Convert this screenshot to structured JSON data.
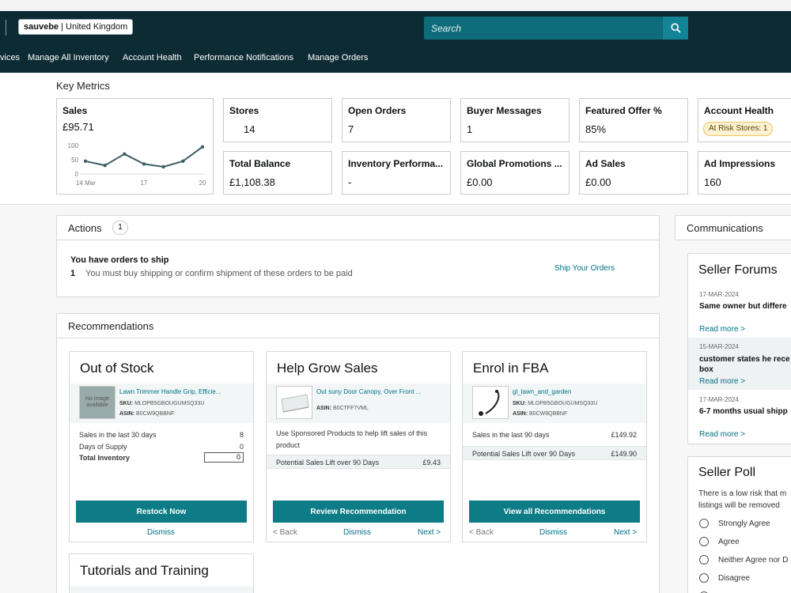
{
  "header": {
    "store_name": "sauvebe",
    "store_region": "United Kingdom",
    "search_placeholder": "Search"
  },
  "nav": {
    "items": [
      "vices",
      "Manage All Inventory",
      "Account Health",
      "Performance Notifications",
      "Manage Orders"
    ]
  },
  "key_metrics": {
    "title": "Key Metrics",
    "sales": {
      "label": "Sales",
      "value": "£95.71",
      "chart_data": {
        "type": "line",
        "x": [
          "14 Mar",
          "15 Mar",
          "16 Mar",
          "17 Mar",
          "18 Mar",
          "19 Mar",
          "20 Mar"
        ],
        "values": [
          45,
          30,
          70,
          35,
          25,
          45,
          95
        ],
        "yticks": [
          "100",
          "50",
          "0"
        ],
        "xticks": [
          "14 Mar",
          "17",
          "20"
        ],
        "ylim": [
          0,
          100
        ]
      }
    },
    "tiles": [
      {
        "label": "Stores",
        "value": "14"
      },
      {
        "label": "Open Orders",
        "value": "7"
      },
      {
        "label": "Buyer Messages",
        "value": "1"
      },
      {
        "label": "Featured Offer %",
        "value": "85%"
      },
      {
        "label": "Account Health",
        "badge": "At Risk Stores: 1"
      },
      {
        "label": "Total Balance",
        "value": "£1,108.38"
      },
      {
        "label": "Inventory Performa...",
        "value": "-"
      },
      {
        "label": "Global Promotions ...",
        "value": "£0.00"
      },
      {
        "label": "Ad Sales",
        "value": "£0.00"
      },
      {
        "label": "Ad Impressions",
        "value": "160"
      }
    ]
  },
  "actions": {
    "title": "Actions",
    "count": "1",
    "heading": "You have orders to ship",
    "item_count": "1",
    "item_text": "You must buy shipping or confirm shipment of these orders to be paid",
    "link": "Ship Your Orders"
  },
  "recommendations": {
    "title": "Recommendations",
    "cards": [
      {
        "title": "Out of Stock",
        "thumb_text": "No image available",
        "product": "Lawn Trimmer Handle Grip, Efficie...",
        "sku_label": "SKU:",
        "sku": "MLOPB5GBOUGUMSQ33U",
        "asin_label": "ASIN:",
        "asin": "B0CW9QBBNF",
        "rows": [
          {
            "label": "Sales in the last 30 days",
            "value": "8"
          },
          {
            "label": "Days of Supply",
            "value": "0"
          },
          {
            "label": "Total Inventory",
            "value": "0"
          }
        ],
        "button": "Restock Now",
        "dismiss": "Dismiss"
      },
      {
        "title": "Help Grow Sales",
        "product": "Out suny Door Canopy, Over Front ...",
        "asin_label": "ASIN:",
        "asin": "B0CTFF7VML",
        "text": "Use Sponsored Products to help lift sales of this product",
        "band_label": "Potential Sales Lift over 90 Days",
        "band_value": "£9.43",
        "button": "Review Recommendation",
        "back": "< Back",
        "dismiss": "Dismiss",
        "next": "Next >"
      },
      {
        "title": "Enrol in FBA",
        "product": "gl_lawn_and_garden",
        "sku_label": "SKU:",
        "sku": "MLOPB5GBOUGUMSQ33U",
        "asin_label": "ASIN:",
        "asin": "B0CW9QBBNF",
        "row_label": "Sales in the last 90 days",
        "row_value": "£149.92",
        "band_label": "Potential Sales Lift over 90 Days",
        "band_value": "£149.90",
        "button": "View all Recommendations",
        "back": "< Back",
        "dismiss": "Dismiss",
        "next": "Next >"
      }
    ]
  },
  "tutorials": {
    "title": "Tutorials and Training"
  },
  "communications": {
    "title": "Communications",
    "forums": {
      "title": "Seller Forums",
      "posts": [
        {
          "date": "17-MAR-2024",
          "title": "Same owner but differe",
          "read_more": "Read more >"
        },
        {
          "date": "15-MAR-2024",
          "title": "customer states he rece",
          "title2": "box",
          "read_more": "Read more >"
        },
        {
          "date": "17-MAR-2024",
          "title": "6-7 months usual shipp",
          "read_more": "Read more >"
        }
      ]
    },
    "poll": {
      "title": "Seller Poll",
      "question1": "There is a low risk that m",
      "question2": "listings will be removed",
      "options": [
        "Strongly Agree",
        "Agree",
        "Neither Agree nor D",
        "Disagree"
      ]
    }
  }
}
